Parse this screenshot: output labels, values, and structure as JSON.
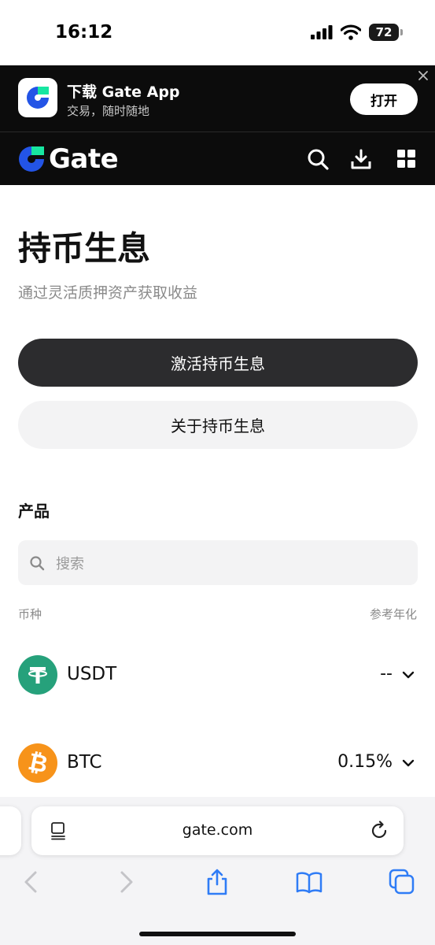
{
  "status_bar": {
    "time": "16:12",
    "battery": "72"
  },
  "app_banner": {
    "title": "下载 Gate App",
    "subtitle": "交易，随时随地",
    "open_label": "打开"
  },
  "nav": {
    "brand": "Gate"
  },
  "main": {
    "title": "持币生息",
    "subtitle": "通过灵活质押资产获取收益",
    "activate_label": "激活持币生息",
    "about_label": "关于持币生息",
    "section_title": "产品",
    "search_placeholder": "搜索",
    "col_coin": "币种",
    "col_apr": "参考年化",
    "assets": [
      {
        "name": "USDT",
        "rate": "--",
        "icon": "tether-icon",
        "color": "#26a17b"
      },
      {
        "name": "BTC",
        "rate": "0.15%",
        "icon": "bitcoin-icon",
        "color": "#f7931a"
      }
    ]
  },
  "browser": {
    "url": "gate.com"
  },
  "colors": {
    "accent": "#2354e6",
    "brand_green": "#17e6a1",
    "dark_bg": "#0c0c0c",
    "primary_button": "#2c2c2e",
    "ios_blue": "#2f7cf6"
  }
}
